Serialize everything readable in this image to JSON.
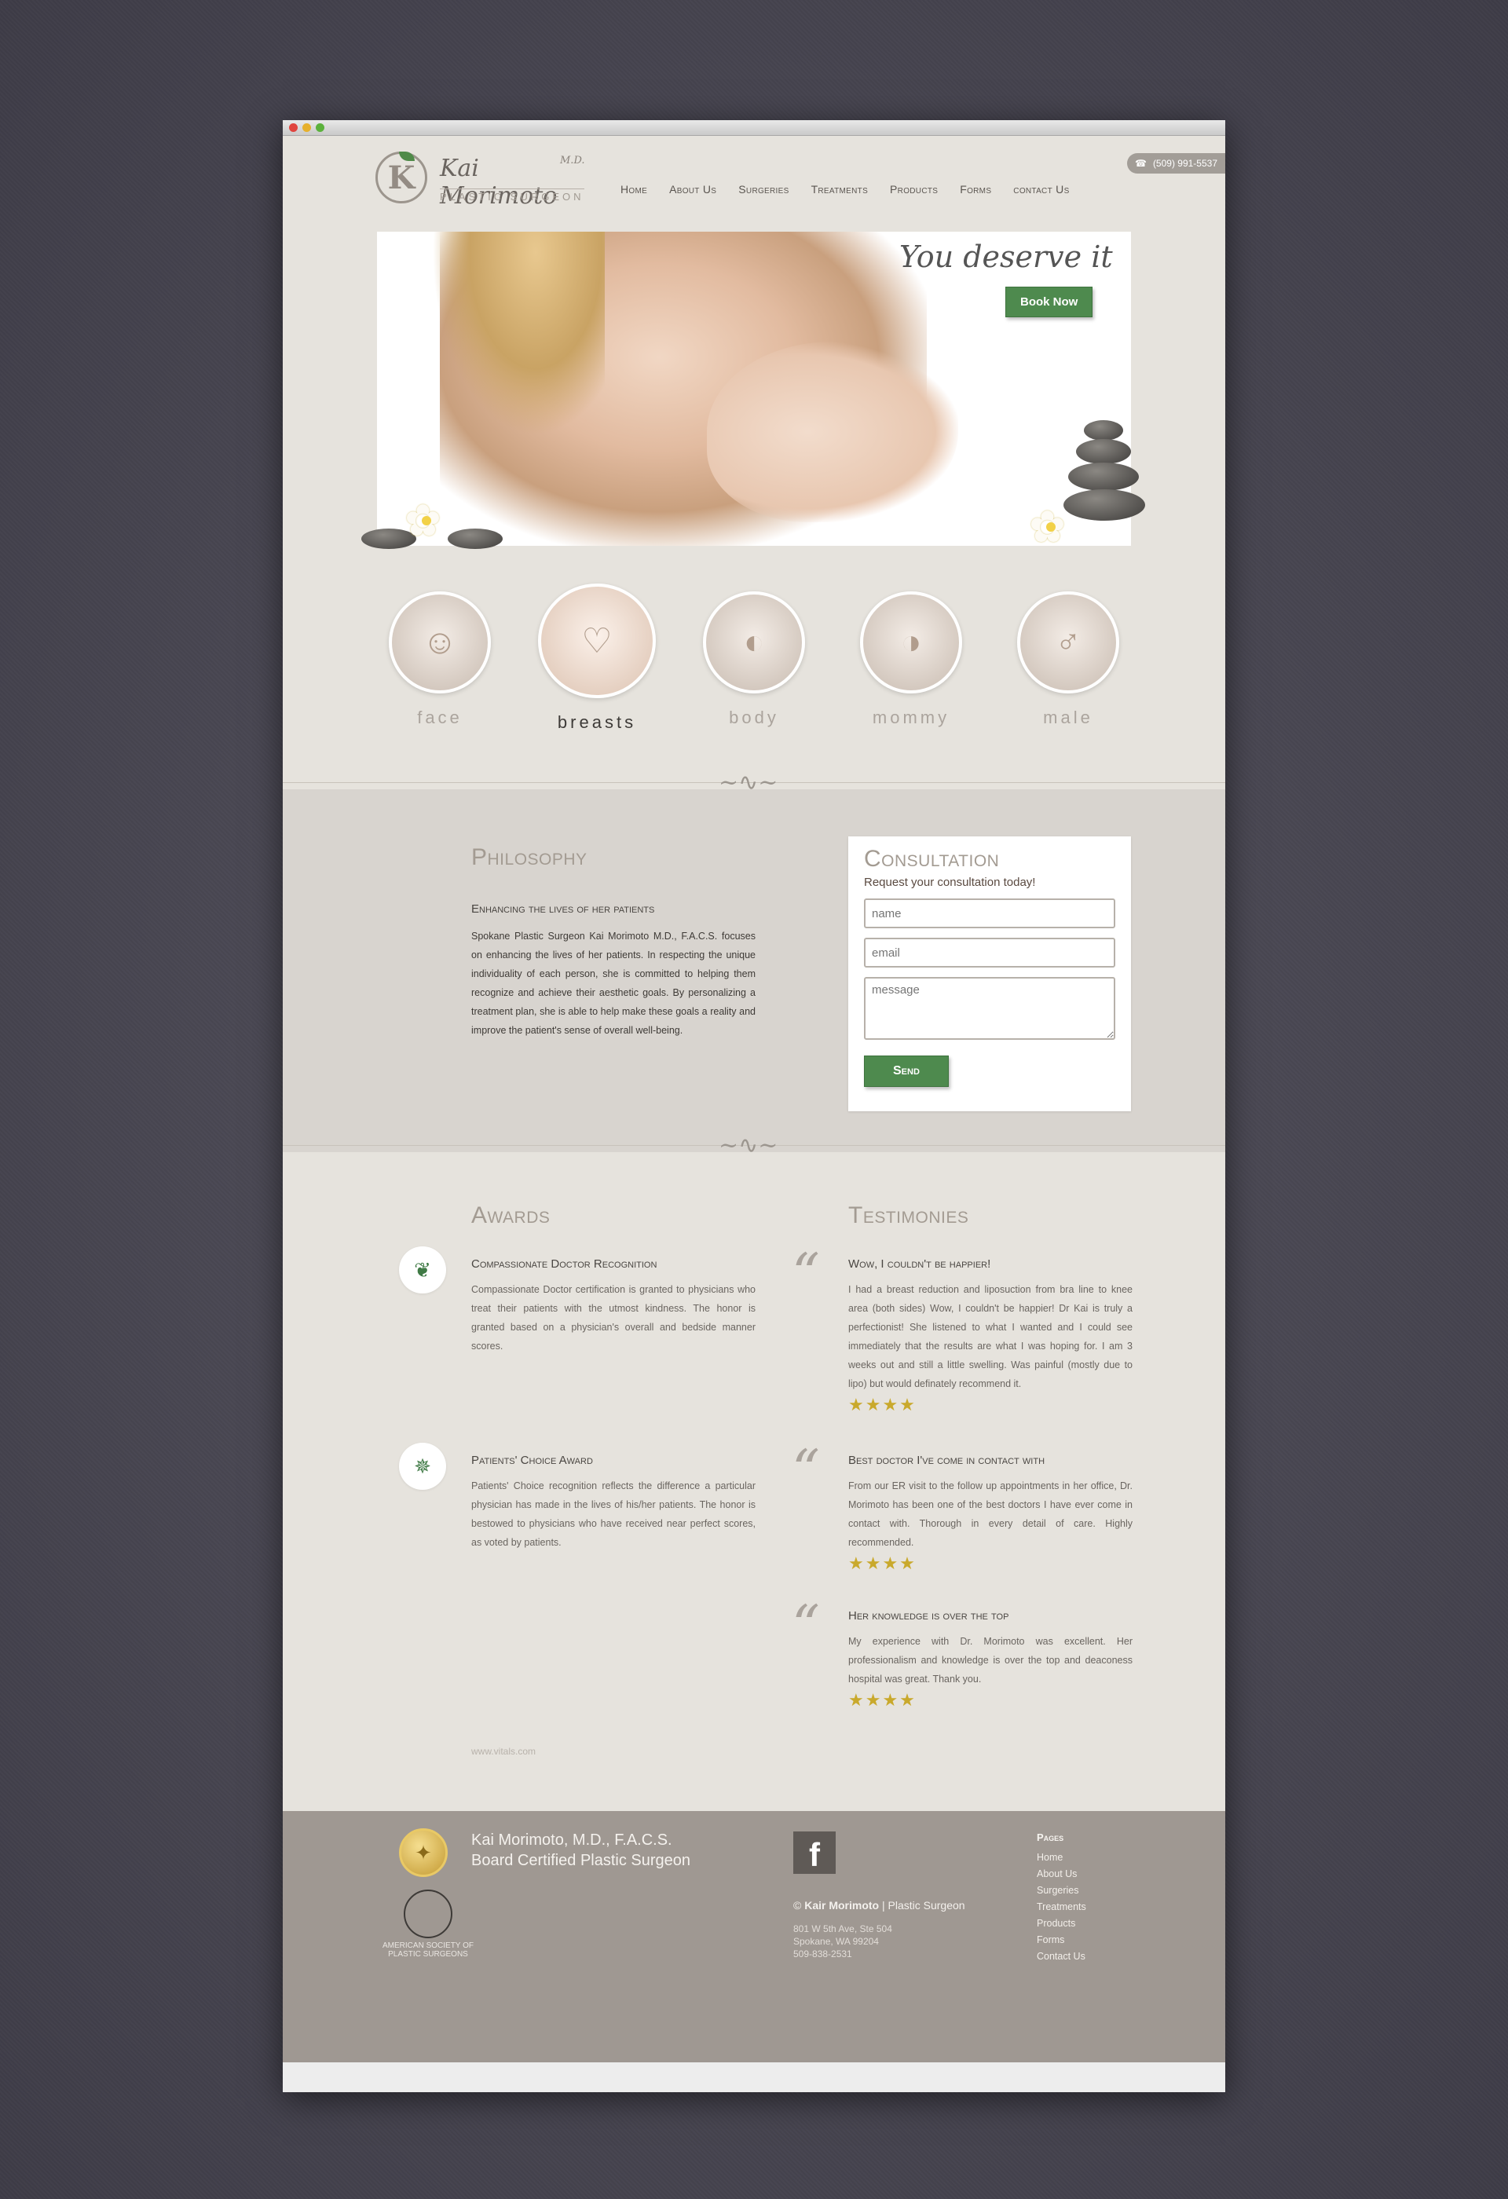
{
  "header": {
    "logo_mark": "K",
    "logo_name": "Kai Morimoto",
    "logo_md": "M.D.",
    "logo_sub": "PLASTIC SURGEON",
    "phone": "(509) 991-5537",
    "nav": [
      "Home",
      "About Us",
      "Surgeries",
      "Treatments",
      "Products",
      "Forms",
      "contact Us"
    ]
  },
  "hero": {
    "tagline": "You deserve it",
    "book_label": "Book Now"
  },
  "categories": [
    {
      "label": "face",
      "icon": "face-icon",
      "active": false
    },
    {
      "label": "breasts",
      "icon": "breasts-icon",
      "active": true
    },
    {
      "label": "body",
      "icon": "body-icon",
      "active": false
    },
    {
      "label": "mommy",
      "icon": "mommy-icon",
      "active": false
    },
    {
      "label": "male",
      "icon": "male-icon",
      "active": false
    }
  ],
  "philosophy": {
    "title": "Philosophy",
    "subtitle": "Enhancing the lives of her patients",
    "text": "Spokane Plastic Surgeon Kai Morimoto M.D., F.A.C.S. focuses on enhancing the lives of her patients. In respecting the unique individuality of each person, she is committed to helping them recognize and achieve their aesthetic goals. By personalizing a treatment plan, she is able to help make these goals a reality and improve the patient's sense of overall well-being."
  },
  "consultation": {
    "title": "Consultation",
    "lead": "Request your consultation today!",
    "name_placeholder": "name",
    "email_placeholder": "email",
    "message_placeholder": "message",
    "send_label": "Send"
  },
  "awards": {
    "title": "Awards",
    "items": [
      {
        "title": "Compassionate Doctor Recognition",
        "text": "Compassionate Doctor certification is granted to physicians who treat their patients with the utmost kindness. The honor is granted based on a physician's overall and bedside manner scores."
      },
      {
        "title": "Patients' Choice Award",
        "text": "Patients' Choice recognition reflects the difference a particular physician has made in the lives of his/her patients. The honor is bestowed to physicians who have received near perfect scores, as voted by patients."
      }
    ],
    "source": "www.vitals.com"
  },
  "testimonies": {
    "title": "Testimonies",
    "items": [
      {
        "title": "Wow, I couldn't be happier!",
        "text": "I had a breast reduction and liposuction from bra line to knee area (both sides) Wow, I couldn't be happier! Dr Kai is truly a perfectionist! She listened to what I wanted and I could see immediately that the results are what I was hoping for. I am 3 weeks out and still a little swelling. Was painful (mostly due to lipo) but would definately recommend it.",
        "stars": 4
      },
      {
        "title": "Best doctor I've come in contact with",
        "text": "From our ER visit to the follow up appointments in her office, Dr. Morimoto has been one of the best doctors I have ever come in contact with. Thorough in every detail of care. Highly recommended.",
        "stars": 4
      },
      {
        "title": "Her knowledge is over the top",
        "text": "My experience with Dr. Morimoto was excellent. Her professionalism and knowledge is over the top and deaconess hospital was great. Thank you.",
        "stars": 4
      }
    ]
  },
  "footer": {
    "name_line1": "Kai Morimoto, M.D., F.A.C.S.",
    "name_line2": "Board Certified Plastic Surgeon",
    "asps_text": "AMERICAN SOCIETY OF PLASTIC SURGEONS",
    "fb_letter": "f",
    "copyright_symbol": "©",
    "copyright_name": "Kair Morimoto",
    "copyright_rest": "| Plastic Surgeon",
    "address_line1": "801 W 5th Ave, Ste 504",
    "address_line2": "Spokane, WA 99204",
    "address_line3": "509-838-2531",
    "pages_title": "Pages",
    "pages": [
      "Home",
      "About Us",
      "Surgeries",
      "Treatments",
      "Products",
      "Forms",
      "Contact Us"
    ]
  },
  "colors": {
    "accent_green": "#4e8a4e",
    "page_bg": "#e6e3dd",
    "band_bg": "#d8d4cf",
    "footer_bg": "#9f9892",
    "star": "#c9a92c"
  }
}
